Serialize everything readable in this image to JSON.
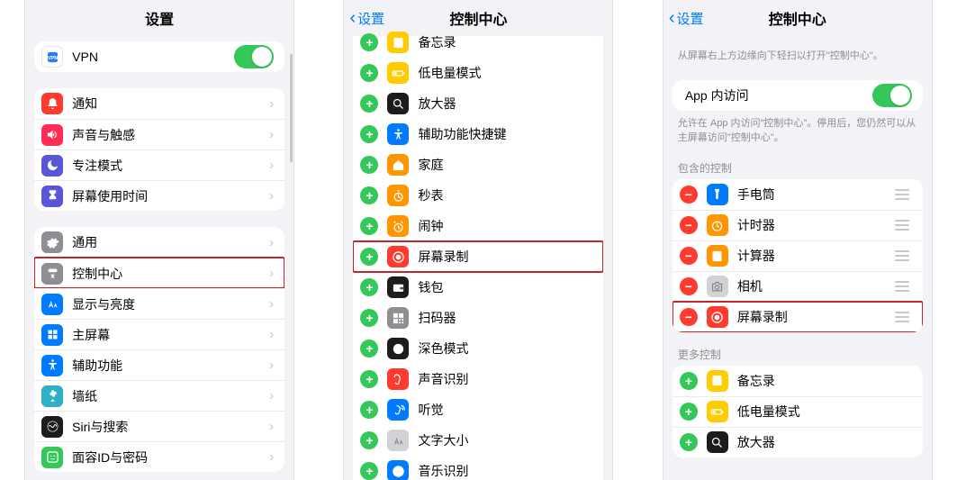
{
  "panel1": {
    "title": "设置",
    "vpn": "VPN",
    "g1": [
      {
        "label": "通知",
        "icon": "bell",
        "color": "ic-red"
      },
      {
        "label": "声音与触感",
        "icon": "sound",
        "color": "ic-pink"
      },
      {
        "label": "专注模式",
        "icon": "moon",
        "color": "ic-indigo"
      },
      {
        "label": "屏幕使用时间",
        "icon": "hourglass",
        "color": "ic-indigo"
      }
    ],
    "g2": [
      {
        "label": "通用",
        "icon": "gear",
        "color": "ic-gray"
      },
      {
        "label": "控制中心",
        "icon": "toggles",
        "color": "ic-gray",
        "hl": true
      },
      {
        "label": "显示与亮度",
        "icon": "aa",
        "color": "ic-blue"
      },
      {
        "label": "主屏幕",
        "icon": "grid",
        "color": "ic-blue"
      },
      {
        "label": "辅助功能",
        "icon": "access",
        "color": "ic-blue"
      },
      {
        "label": "墙纸",
        "icon": "flower",
        "color": "ic-teal"
      },
      {
        "label": "Siri与搜索",
        "icon": "siri",
        "color": "ic-dark"
      },
      {
        "label": "面容ID与密码",
        "icon": "face",
        "color": "ic-green"
      }
    ]
  },
  "panel2": {
    "back": "设置",
    "title": "控制中心",
    "items": [
      {
        "label": "备忘录",
        "icon": "note",
        "color": "ic-yellow"
      },
      {
        "label": "低电量模式",
        "icon": "battery",
        "color": "ic-yellow"
      },
      {
        "label": "放大器",
        "icon": "zoom",
        "color": "ic-dark"
      },
      {
        "label": "辅助功能快捷键",
        "icon": "access",
        "color": "ic-blue"
      },
      {
        "label": "家庭",
        "icon": "home",
        "color": "ic-orange"
      },
      {
        "label": "秒表",
        "icon": "stopwatch",
        "color": "ic-orange"
      },
      {
        "label": "闹钟",
        "icon": "alarm",
        "color": "ic-orange"
      },
      {
        "label": "屏幕录制",
        "icon": "record",
        "color": "ic-red",
        "hl": true
      },
      {
        "label": "钱包",
        "icon": "wallet",
        "color": "ic-dark"
      },
      {
        "label": "扫码器",
        "icon": "qr",
        "color": "ic-gray"
      },
      {
        "label": "深色模式",
        "icon": "dark",
        "color": "ic-dark"
      },
      {
        "label": "声音识别",
        "icon": "ear",
        "color": "ic-red"
      },
      {
        "label": "听觉",
        "icon": "hearing",
        "color": "ic-blue"
      },
      {
        "label": "文字大小",
        "icon": "aa",
        "color": "ic-lgray"
      },
      {
        "label": "音乐识别",
        "icon": "shazam",
        "color": "ic-blue"
      }
    ]
  },
  "panel3": {
    "back": "设置",
    "title": "控制中心",
    "tip": "从屏幕右上方边缘向下轻扫以打开\"控制中心\"。",
    "access_label": "App 内访问",
    "access_note": "允许在 App 内访问\"控制中心\"。停用后，您仍然可以从主屏幕访问\"控制中心\"。",
    "included_title": "包含的控制",
    "included": [
      {
        "label": "手电筒",
        "icon": "torch",
        "color": "ic-blue"
      },
      {
        "label": "计时器",
        "icon": "timer",
        "color": "ic-orange"
      },
      {
        "label": "计算器",
        "icon": "calc",
        "color": "ic-orange"
      },
      {
        "label": "相机",
        "icon": "camera",
        "color": "ic-lgray"
      },
      {
        "label": "屏幕录制",
        "icon": "record",
        "color": "ic-red",
        "hl": true
      }
    ],
    "more_title": "更多控制",
    "more": [
      {
        "label": "备忘录",
        "icon": "note",
        "color": "ic-yellow"
      },
      {
        "label": "低电量模式",
        "icon": "battery",
        "color": "ic-yellow"
      },
      {
        "label": "放大器",
        "icon": "zoom",
        "color": "ic-dark"
      }
    ]
  }
}
